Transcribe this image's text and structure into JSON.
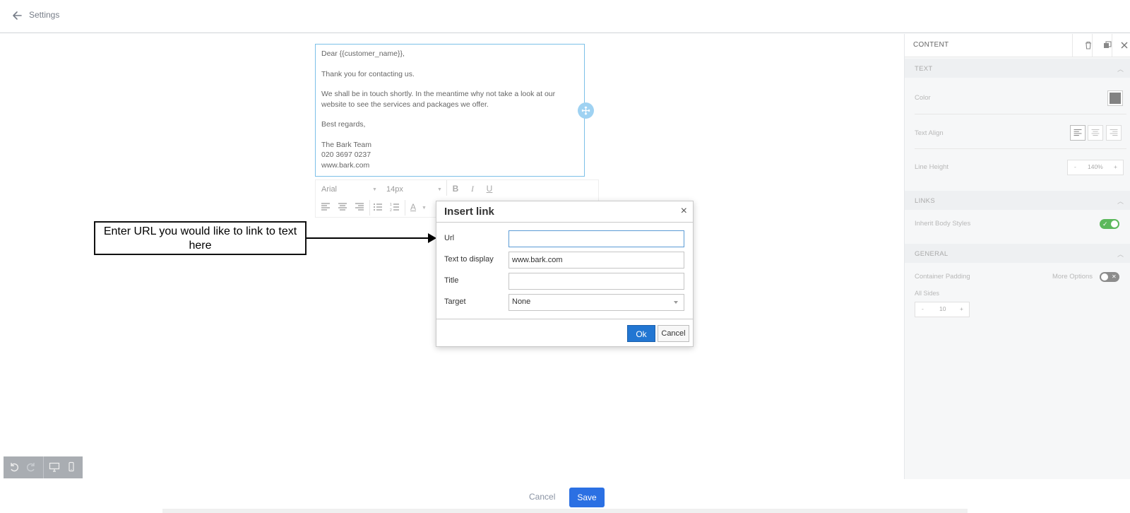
{
  "topbar": {
    "title": "Settings",
    "back_icon": "arrow-left-icon"
  },
  "email": {
    "greeting": "Dear {{customer_name}},",
    "line1": "Thank you for contacting us.",
    "line2a": "We shall be in touch shortly. In the meantime why not take a look at our",
    "line2b": "website to see the services and packages we offer.",
    "closing": "Best regards,",
    "sig_team": "The Bark Team",
    "sig_phone": "020 3697 0237",
    "sig_web": "www.bark.com"
  },
  "editor_toolbar": {
    "font": "Arial",
    "size": "14px",
    "bold": "B",
    "italic": "I",
    "underline": "U",
    "text_color": "A"
  },
  "annotation": {
    "text_line1": "Enter URL you would like to link to text",
    "text_line2": "here"
  },
  "dialog": {
    "title": "Insert link",
    "close": "×",
    "url_label": "Url",
    "url_value": "",
    "display_label": "Text to display",
    "display_value": "www.bark.com",
    "title_label": "Title",
    "title_value": "",
    "target_label": "Target",
    "target_value": "None",
    "ok": "Ok",
    "cancel": "Cancel"
  },
  "panel": {
    "title": "CONTENT",
    "text_section": "TEXT",
    "color_label": "Color",
    "align_label": "Text Align",
    "line_height_label": "Line Height",
    "line_height_minus": "-",
    "line_height_value": "140%",
    "line_height_plus": "+",
    "links_section": "LINKS",
    "inherit_label": "Inherit Body Styles",
    "inherit_on": true,
    "general_section": "GENERAL",
    "padding_label": "Container Padding",
    "more_options": "More Options",
    "more_options_on": false,
    "all_sides_label": "All Sides",
    "padding_minus": "-",
    "padding_value": "10",
    "padding_plus": "+",
    "swatch_color": "#828282",
    "toggle_on_color": "#5cb85c"
  },
  "bottom": {
    "cancel": "Cancel",
    "save": "Save"
  }
}
